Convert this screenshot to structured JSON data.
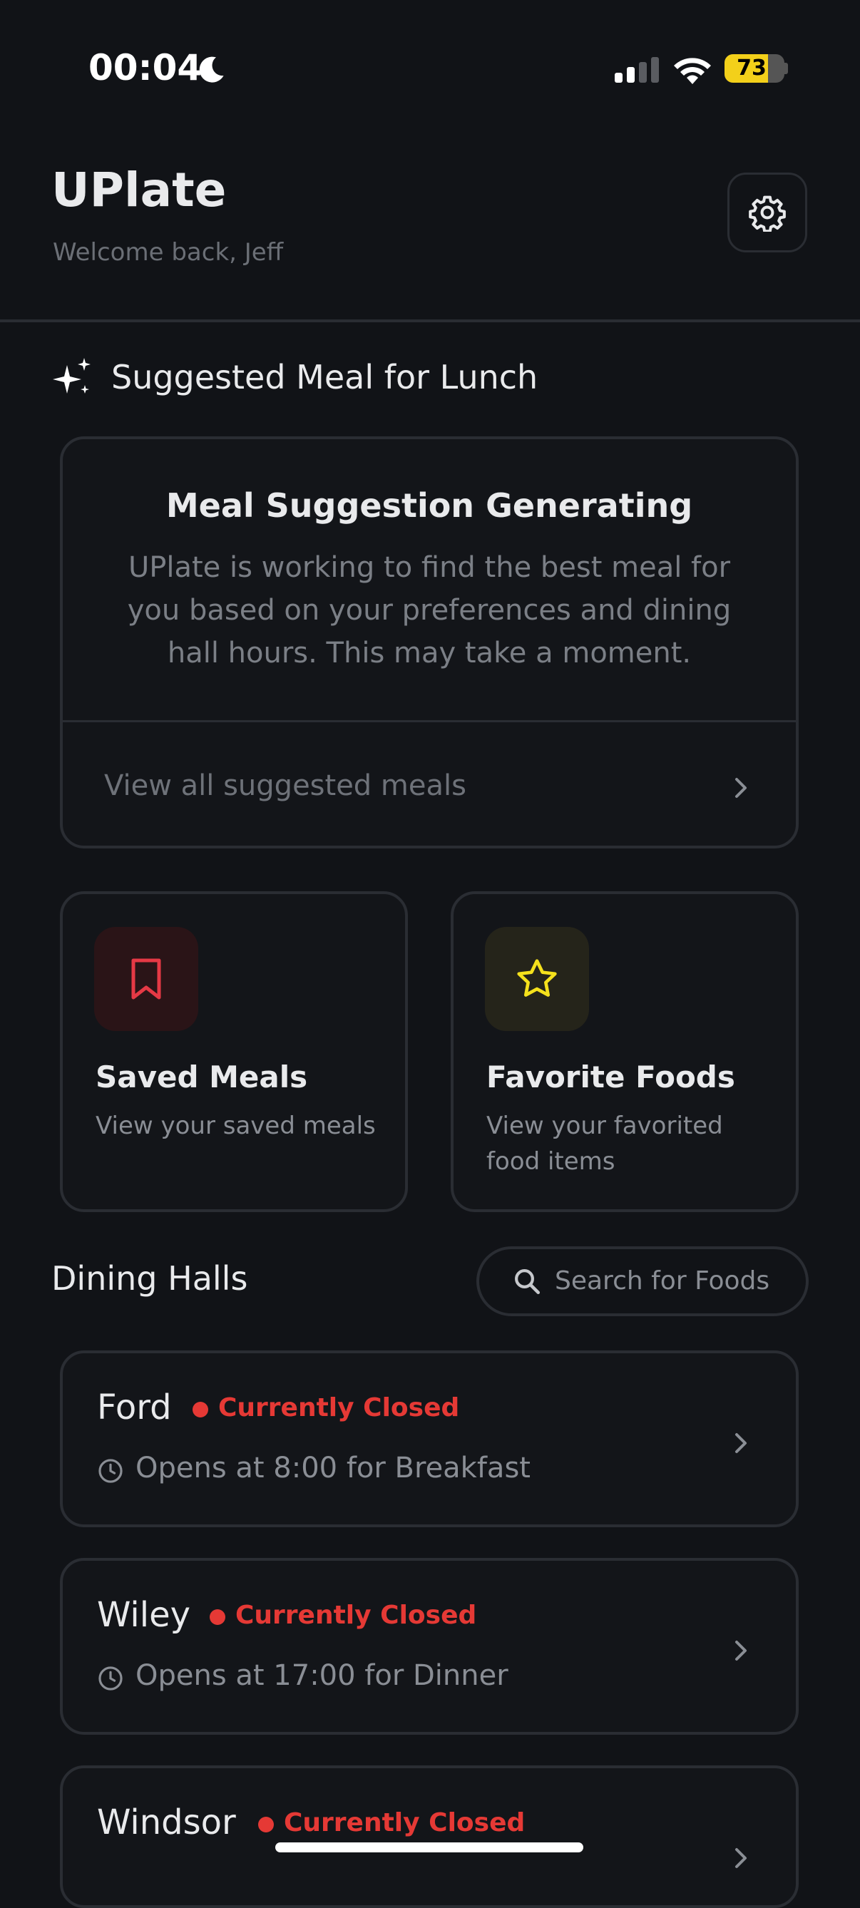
{
  "status_bar": {
    "time": "00:04",
    "battery_level": 73,
    "battery_label": "73",
    "icons": [
      "moon-icon",
      "cellular-signal-icon",
      "wifi-icon",
      "battery-icon"
    ]
  },
  "header": {
    "title": "UPlate",
    "subtitle": "Welcome back, Jeff",
    "settings_icon": "gear-icon"
  },
  "suggestion": {
    "section_title": "Suggested Meal for Lunch",
    "card_title": "Meal Suggestion Generating",
    "card_body": "UPlate is working to find the best meal for you based on your preferences and dining hall hours. This may take a moment.",
    "view_all_label": "View all suggested meals"
  },
  "tiles": [
    {
      "title": "Saved Meals",
      "description": "View your saved meals",
      "icon": "bookmark-icon",
      "accent": "#e53945",
      "icon_bg": "#2a1417"
    },
    {
      "title": "Favorite Foods",
      "description": "View your favorited food items",
      "icon": "star-icon",
      "accent": "#f5e11c",
      "icon_bg": "#25241a"
    }
  ],
  "dining": {
    "section_title": "Dining Halls",
    "search_label": "Search for Foods",
    "halls": [
      {
        "name": "Ford",
        "status": "Currently Closed",
        "opens": "Opens at 8:00 for Breakfast"
      },
      {
        "name": "Wiley",
        "status": "Currently Closed",
        "opens": "Opens at 17:00 for Dinner"
      },
      {
        "name": "Windsor",
        "status": "Currently Closed",
        "opens": ""
      }
    ]
  },
  "colors": {
    "background": "#111317",
    "card_border": "#2a2d33",
    "closed_red": "#e53935",
    "battery_yellow": "#f3d01a"
  }
}
